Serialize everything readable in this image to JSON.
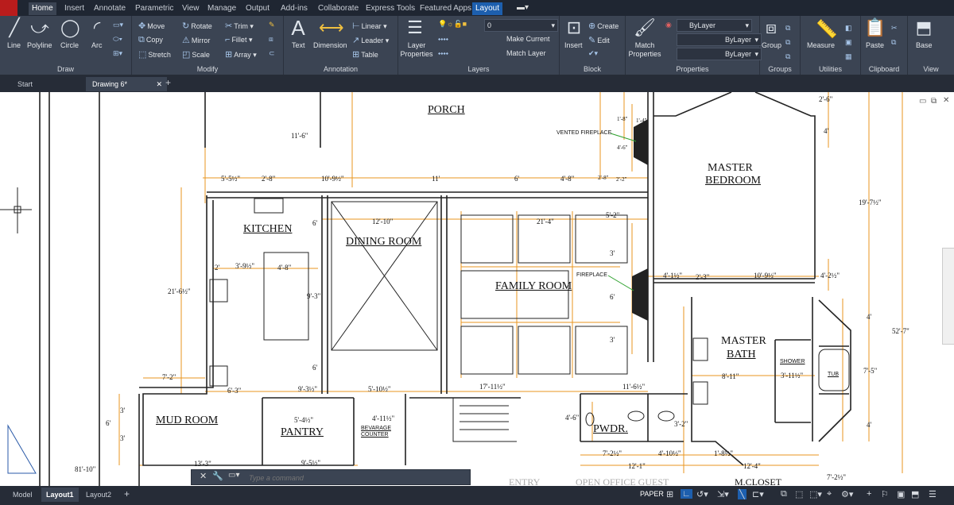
{
  "ribbon_tabs": [
    "Home",
    "Insert",
    "Annotate",
    "Parametric",
    "View",
    "Manage",
    "Output",
    "Add-ins",
    "Collaborate",
    "Express Tools",
    "Featured Apps",
    "Layout"
  ],
  "panels": {
    "draw": {
      "title": "Draw",
      "line": "Line",
      "polyline": "Polyline",
      "circle": "Circle",
      "arc": "Arc"
    },
    "modify": {
      "title": "Modify",
      "move": "Move",
      "rotate": "Rotate",
      "trim": "Trim",
      "copy": "Copy",
      "mirror": "Mirror",
      "fillet": "Fillet",
      "stretch": "Stretch",
      "scale": "Scale",
      "array": "Array"
    },
    "annotation": {
      "title": "Annotation",
      "text": "Text",
      "dimension": "Dimension",
      "linear": "Linear",
      "leader": "Leader",
      "table": "Table"
    },
    "layers": {
      "title": "Layers",
      "layer_props": "Layer Properties",
      "layer_value": "0",
      "make_current": "Make Current",
      "match_layer": "Match Layer"
    },
    "block": {
      "title": "Block",
      "insert": "Insert",
      "create": "Create",
      "edit": "Edit"
    },
    "properties": {
      "title": "Properties",
      "match": "Match Properties",
      "bylayer1": "ByLayer",
      "bylayer2": "ByLayer",
      "bylayer3": "ByLayer"
    },
    "groups": {
      "title": "Groups",
      "group": "Group"
    },
    "utilities": {
      "title": "Utilities",
      "measure": "Measure"
    },
    "clipboard": {
      "title": "Clipboard",
      "paste": "Paste"
    },
    "view": {
      "title": "View",
      "base": "Base"
    }
  },
  "file_tabs": [
    "Start",
    "Drawing 6*"
  ],
  "rooms": {
    "porch": "PORCH",
    "kitchen": "KITCHEN",
    "dining": "DINING ROOM",
    "family": "FAMILY ROOM",
    "master_bed_1": "MASTER",
    "master_bed_2": "BEDROOM",
    "master_bath_1": "MASTER",
    "master_bath_2": "BATH",
    "mud": "MUD ROOM",
    "pantry": "PANTRY",
    "pwdr": "PWDR.",
    "shower": "SHOWER",
    "tub": "TUB",
    "bev1": "BEVARAGE",
    "bev2": "COUNTER",
    "vented_fp": "VENTED FIREPLACE",
    "fireplace": "FIREPLACE",
    "entry": "ENTRY",
    "open_office": "OPEN OFFICE GUEST",
    "mcloset": "M.CLOSET"
  },
  "dims": {
    "d_11_6": "11'-6\"",
    "d_5_5": "5'-5½\"",
    "d_2_8": "2'-8\"",
    "d_10_9": "10'-9½\"",
    "d_11": "11'",
    "d_6": "6'",
    "d_4_8": "4'-8\"",
    "d_2_8b": "2'-8\"",
    "d_2_2": "2'-2\"",
    "d_1_8": "1'-8\"",
    "d_1_4": "1'-4\"",
    "d_4_6": "4'-6\"",
    "d_12_10": "12'-10\"",
    "d_21_4": "21'-4\"",
    "d_5_2": "5'-2\"",
    "d_6b": "6'",
    "d_3": "3'",
    "d_2": "2'",
    "d_3_9": "3'-9½\"",
    "d_4_8b": "4'-8\"",
    "d_21_6": "21'-6½\"",
    "d_9_3": "9'-3\"",
    "d_6c": "6'",
    "d_3b": "3'",
    "d_6d": "6'",
    "d_3c": "3'",
    "d_4_1": "4'-1½\"",
    "d_2_3": "2'-3\"",
    "d_10_9b": "10'-9½\"",
    "d_4_2": "4'-2½\"",
    "d_19_7": "19'-7½\"",
    "d_2_6": "2'-6\"",
    "d_4": "4'",
    "d_4b": "4'",
    "d_52_7": "52'-7\"",
    "d_7_5": "7'-5\"",
    "d_8_11": "8'-11\"",
    "d_3_11": "3'-11½\"",
    "d_4c": "4'",
    "d_7_2": "7'-2\"",
    "d_6_3": "6'-3\"",
    "d_9_3b": "9'-3½\"",
    "d_5_10": "5'-10½\"",
    "d_17_11": "17'-11½\"",
    "d_11_6b": "11'-6½\"",
    "d_3d": "3'",
    "d_6e": "6'",
    "d_3e": "3'",
    "d_5_4": "5'-4½\"",
    "d_4_11": "4'-11½\"",
    "d_4_6b": "4'-6\"",
    "d_3_2": "3'-2\"",
    "d_13_3": "13'-3\"",
    "d_9_5": "9'-5½\"",
    "d_81_10": "81'-10\"",
    "d_7_2b": "7'-2½\"",
    "d_4_10": "4'-10½\"",
    "d_1_8b": "1'-8½\"",
    "d_12_1": "12'-1\"",
    "d_12_4": "12'-4\"",
    "d_7_2c": "7'-2½\""
  },
  "command": {
    "placeholder": "Type a command"
  },
  "status_tabs": [
    "Model",
    "Layout1",
    "Layout2"
  ],
  "status_paper": "PAPER",
  "colors": {
    "dim_orange": "#e8951f",
    "ribbon": "#3b4453",
    "accent": "#1d5fae"
  }
}
